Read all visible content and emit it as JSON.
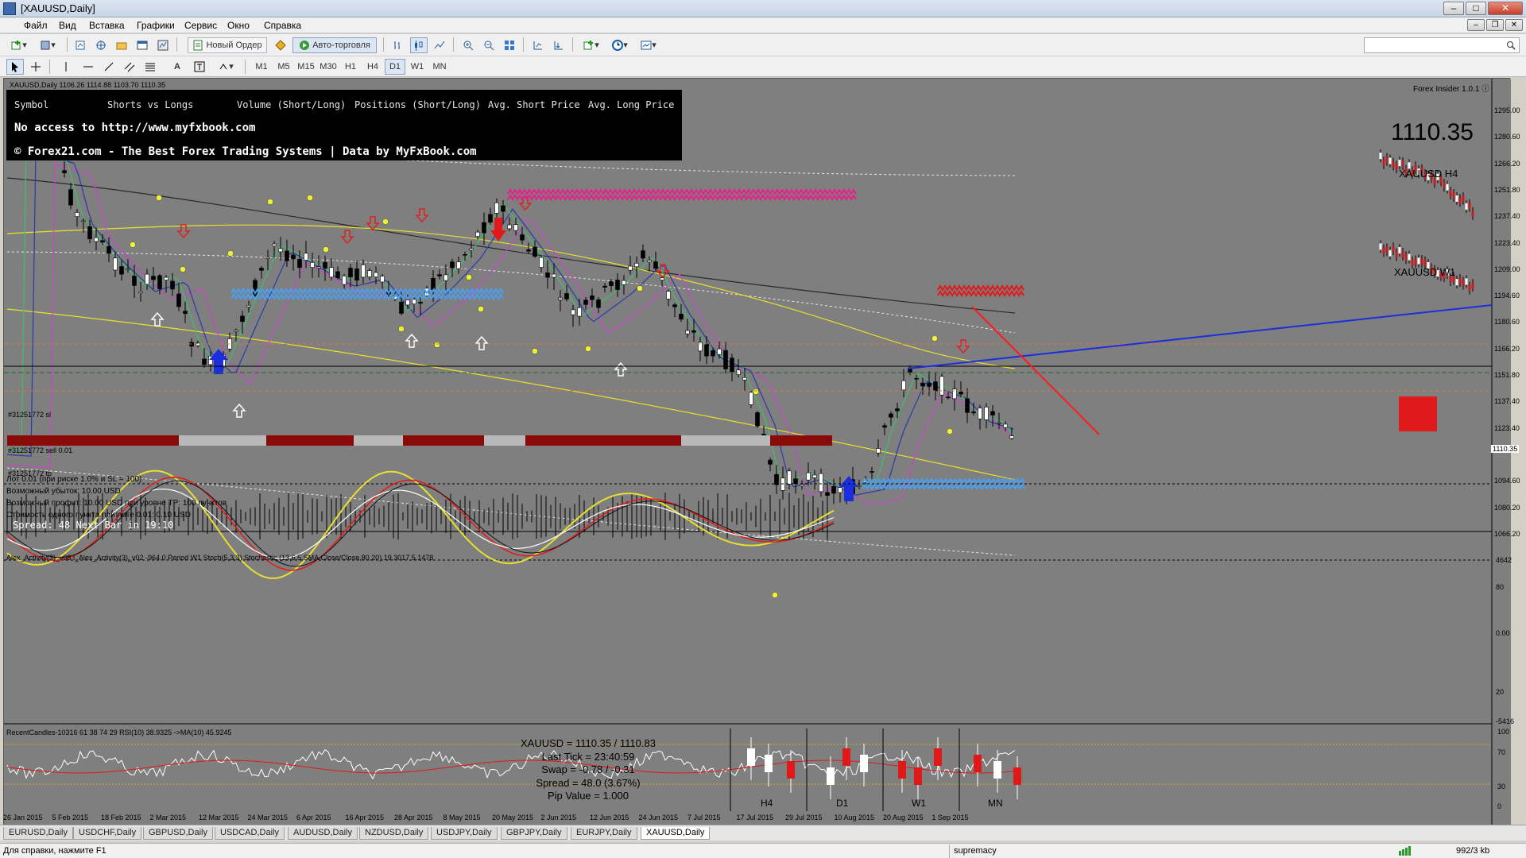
{
  "window": {
    "title": "[XAUUSD,Daily]"
  },
  "menu": [
    "Файл",
    "Вид",
    "Вставка",
    "Графики",
    "Сервис",
    "Окно",
    "Справка"
  ],
  "toolbar": {
    "new_order": "Новый Ордер",
    "auto_trading": "Авто-торговля",
    "search_placeholder": ""
  },
  "timeframes": [
    "M1",
    "M5",
    "M15",
    "M30",
    "H1",
    "H4",
    "D1",
    "W1",
    "MN"
  ],
  "timeframe_active": "D1",
  "chart": {
    "header": "XAUUSD,Daily  1106.26 1114.88 1103.70 1110.35",
    "indicator_name": "Forex Insider 1.0.1 ⓘ",
    "big_price": "1110.35",
    "mini_h4": "XAUUSD H4",
    "mini_w1": "XAUUSD W1",
    "sl_label": "#31251772 sl",
    "sell_label": "#31251772 sell 0.01",
    "tp_label": "#31251772 tp",
    "lot_lines": [
      "Лот 0.01 (при риске 1.0% и SL = 100)",
      "Возможный убыток: 10.00 USD",
      "Возможный профит: 10.00 USD при уровне TP: 100 пунктов",
      "Стоимость одного пункта при лоте 0.01: 0.10 USD"
    ],
    "spread_line": "Spread: 48   Next Bar in 19:10",
    "info_panel": {
      "headers": [
        "Symbol",
        "Shorts vs Longs",
        "Volume (Short/Long)",
        "Positions (Short/Long)",
        "Avg. Short Price",
        "Avg. Long Price"
      ],
      "line1": "No access to http://www.myfxbook.com",
      "line2": "© Forex21.com - The Best Forex Trading Systems | Data by MyFxBook.com"
    },
    "price_axis": [
      "1295.00",
      "1280.60",
      "1266.20",
      "1251.80",
      "1237.40",
      "1223.40",
      "1209.00",
      "1194.60",
      "1180.60",
      "1166.20",
      "1151.80",
      "1137.40",
      "1123.40",
      "1110.35",
      "1094.60",
      "1080.20",
      "1066.20"
    ],
    "osc_title": "Alex_Activity(3)_v08  i_Alex_Activity(3)_v02 -964.0  Period W1 Stoch(5,3,3)  Stochastic (13,6.5,SMA,Close/Close,80,20) 19.3017 5.1478",
    "osc_axis": [
      "4642",
      "80",
      "0.00",
      "20",
      "-5416"
    ],
    "rsi_title": "RecentCandles-10316 61 38 74 29  RSI(10) 38.9325  ->MA(10) 45.9245",
    "rsi_axis": [
      "100",
      "70",
      "30",
      "0"
    ],
    "quote_box": [
      "XAUUSD = 1110.35 / 1110.83",
      "Last Tick = 23:40:59",
      "Swap = -0.78 / -0.31",
      "Spread = 48.0  (3.67%)",
      "Pip Value = 1.000"
    ],
    "candle_tf": [
      "H4",
      "D1",
      "W1",
      "MN"
    ],
    "dates": [
      "26 Jan 2015",
      "5 Feb 2015",
      "18 Feb 2015",
      "2 Mar 2015",
      "12 Mar 2015",
      "24 Mar 2015",
      "6 Apr 2015",
      "16 Apr 2015",
      "28 Apr 2015",
      "8 May 2015",
      "20 May 2015",
      "2 Jun 2015",
      "12 Jun 2015",
      "24 Jun 2015",
      "7 Jul 2015",
      "17 Jul 2015",
      "29 Jul 2015",
      "10 Aug 2015",
      "20 Aug 2015",
      "1 Sep 2015"
    ]
  },
  "tabs": [
    "EURUSD,Daily",
    "USDCHF,Daily",
    "GBPUSD,Daily",
    "USDCAD,Daily",
    "AUDUSD,Daily",
    "NZDUSD,Daily",
    "USDJPY,Daily",
    "GBPJPY,Daily",
    "EURJPY,Daily",
    "XAUUSD,Daily"
  ],
  "active_tab": "XAUUSD,Daily",
  "status": {
    "help": "Для справки, нажмите F1",
    "profile": "supremacy",
    "traffic": "992/3 kb"
  },
  "colors": {
    "chart_bg": "#7f7f7f",
    "up_arrow": "#ffffff",
    "down_arrow": "#e02020",
    "blue_line": "#1c2fd8",
    "red_line": "#ff1a1a",
    "ma_yellow": "#e8e02c",
    "ma_magenta": "#cc44cc",
    "ma_green": "#3fbf6a",
    "ma_navy": "#2a3aa8"
  }
}
